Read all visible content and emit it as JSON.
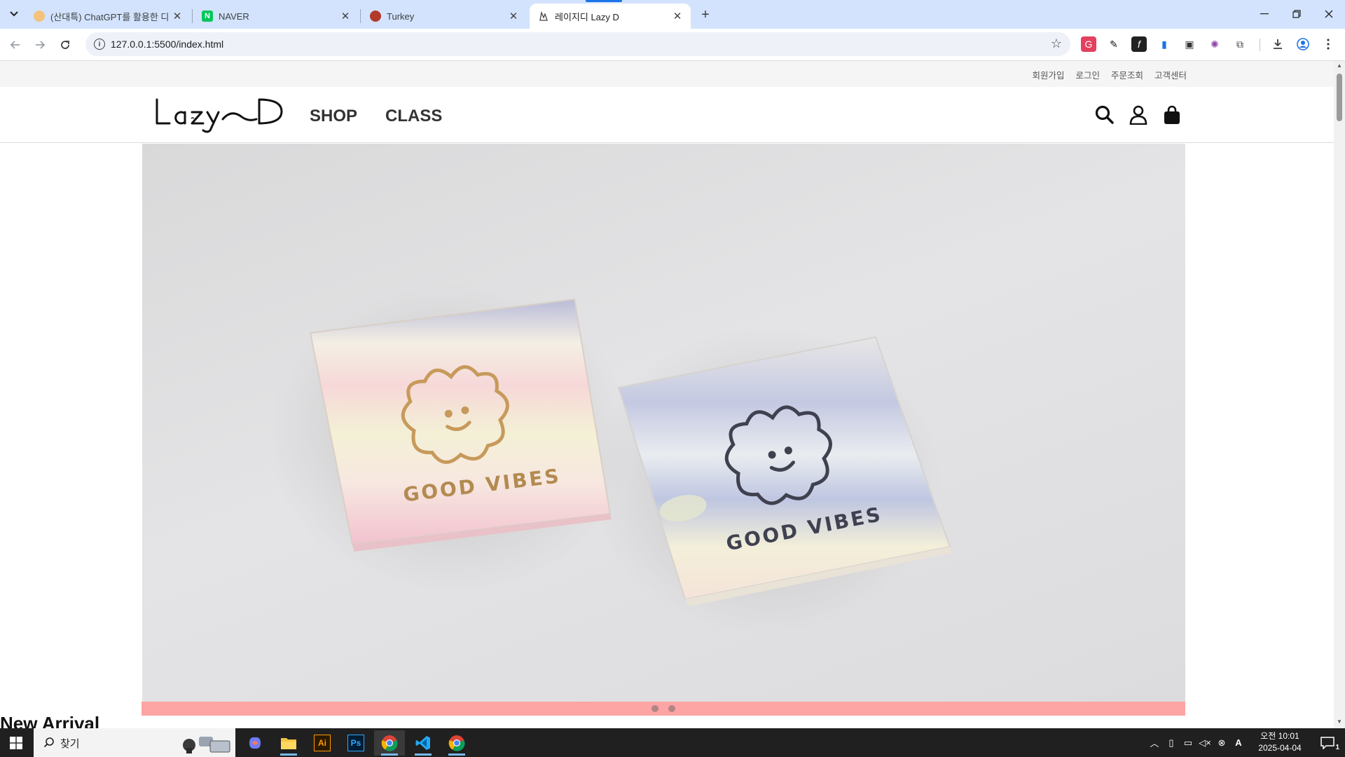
{
  "browser": {
    "tabs": [
      {
        "title": "(산대특) ChatGPT를 활용한 디",
        "active": false
      },
      {
        "title": "NAVER",
        "active": false
      },
      {
        "title": "Turkey",
        "active": false
      },
      {
        "title": "레이지디 Lazy D",
        "active": true
      }
    ],
    "new_tab": "+",
    "url": "127.0.0.1:5500/index.html"
  },
  "site": {
    "util_links": [
      "회원가입",
      "로그인",
      "주문조회",
      "고객센터"
    ],
    "logo_text": "LazyD",
    "nav": [
      "SHOP",
      "CLASS"
    ],
    "hero": {
      "soap_text_left": "GOOD VIBES",
      "soap_text_right": "GOOD VIBES",
      "slide_count": 2,
      "active_slide": 1
    },
    "section_title": "New Arrival"
  },
  "taskbar": {
    "search_label": "찾기",
    "clock_ampm_time": "오전 10:01",
    "clock_date": "2025-04-04",
    "notification_count": "1",
    "ime_label": "A"
  },
  "colors": {
    "tabstrip_bg": "#d3e3fd",
    "pager_bar": "#fda4a4",
    "taskbar_bg": "#202020"
  }
}
